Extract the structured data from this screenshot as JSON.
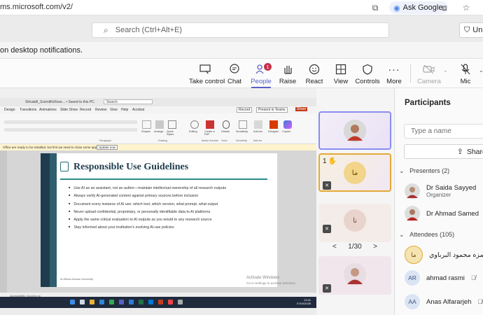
{
  "browser": {
    "url": "ms.microsoft.com/v2/",
    "ask_google": "Ask Google"
  },
  "search": {
    "placeholder": "Search (Ctrl+Alt+E)",
    "un_label": "Un"
  },
  "notification": {
    "text": "on desktop notifications."
  },
  "toolbar": {
    "take_control": "Take control",
    "chat": "Chat",
    "people": "People",
    "people_badge": "1",
    "raise": "Raise",
    "react": "React",
    "view": "View",
    "controls": "Controls",
    "more": "More",
    "camera": "Camera",
    "mic": "Mic"
  },
  "slide": {
    "title": "Responsible Use Guidelines",
    "bullets": [
      "Use AI as an assistant, not an author—maintain intellectual ownership of all research outputs",
      "Always verify AI-generated content against primary sources before inclusion",
      "Document every instance of AI use: which tool, which version, what prompt, what output",
      "Never upload confidential, proprietary, or personally identifiable data to AI platforms",
      "Apply the same critical evaluation to AI outputs as you would to any research source",
      "Stay informed about your institution's evolving AI-use policies"
    ],
    "footer": "Al-Hikma Amman University",
    "activate": "Activate Windows",
    "activate_sub": "Go to Settings to activate Windows."
  },
  "ppt": {
    "title": "Shivakill_ScientificRese... • Saved to this PC",
    "search": "Search",
    "menu": [
      "Design",
      "Transitions",
      "Animations",
      "Slide Show",
      "Record",
      "Review",
      "View",
      "Help",
      "Acrobat"
    ],
    "record": "Record",
    "present": "Present in Teams",
    "share": "Share",
    "warning": "Office are ready to be installed, but first we need to close some apps.",
    "update": "Update now",
    "ribbon": [
      "Shapes",
      "Arrange",
      "Quick Styles",
      "Editing",
      "Create a PDF",
      "Dictate",
      "Sensitivity",
      "Add-ins",
      "Designer",
      "Copilot"
    ],
    "ribbon_groups": [
      "Paragraph",
      "Drawing",
      "Adobe Acrobat",
      "Voice",
      "Sensitivity",
      "Add-ins"
    ],
    "status": "Accessibility: Good to go",
    "time": "13:41",
    "date": "07/04/2026"
  },
  "tiles": [
    {
      "label": ""
    },
    {
      "label": "ما",
      "hand": "1"
    },
    {
      "label": "نا"
    },
    {
      "label": ""
    }
  ],
  "pager": {
    "prev": "<",
    "text": "1/30",
    "next": ">"
  },
  "participants": {
    "title": "Participants",
    "placeholder": "Type a name",
    "share": "Share",
    "presenters_header": "Presenters (2)",
    "presenters": [
      {
        "name": "Dr Saida Sayyed",
        "role": "Organizer"
      },
      {
        "name": "Dr Ahmad Samed",
        "role": ""
      }
    ],
    "attendees_header": "Attendees (105)",
    "attendees": [
      {
        "name": "حمزه محمود البرباوي",
        "initials": "ما"
      },
      {
        "name": "ahmad rasmi",
        "initials": "AR"
      },
      {
        "name": "Anas Alfararjeh",
        "initials": "AA"
      }
    ]
  }
}
